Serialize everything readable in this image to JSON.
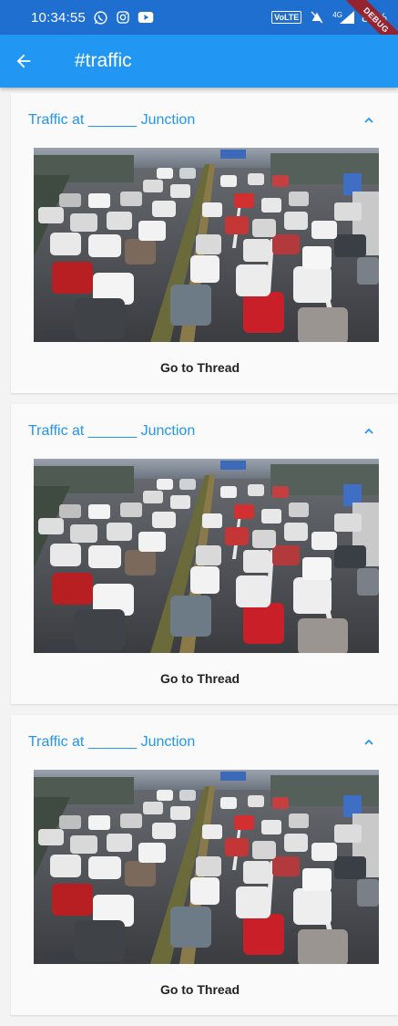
{
  "status_bar": {
    "time": "10:34:55",
    "left_icons": [
      "whatsapp-icon",
      "instagram-icon",
      "youtube-icon"
    ],
    "volte": "VoLTE",
    "network": "4G",
    "battery": "82%",
    "debug_banner": "DEBUG"
  },
  "app_bar": {
    "back_icon": "arrow-back-icon",
    "title": "#traffic",
    "color": "#2196f3"
  },
  "posts": [
    {
      "title": "Traffic at ______ Junction",
      "image": "traffic-jam-photo",
      "action": "Go to Thread",
      "expanded": true
    },
    {
      "title": "Traffic at ______ Junction",
      "image": "traffic-jam-photo",
      "action": "Go to Thread",
      "expanded": true
    },
    {
      "title": "Traffic at ______ Junction",
      "image": "traffic-jam-photo",
      "action": "Go to Thread",
      "expanded": true
    }
  ]
}
